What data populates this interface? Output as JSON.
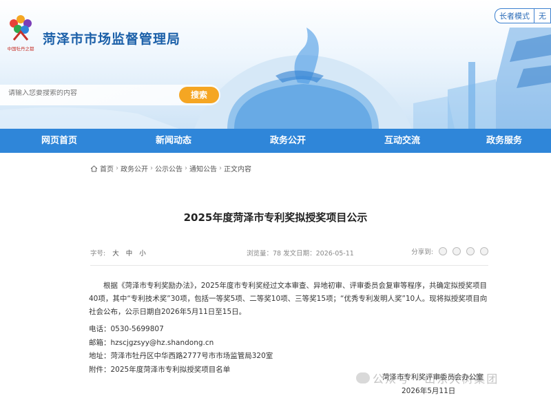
{
  "header": {
    "site_title": "菏泽市市场监督管理局",
    "logo_caption": "中国牡丹之都",
    "top_links": [
      "长者模式",
      "无"
    ]
  },
  "search": {
    "placeholder": "请输入您要搜索的内容",
    "button": "搜索"
  },
  "nav": {
    "items": [
      "网页首页",
      "新闻动态",
      "政务公开",
      "互动交流",
      "政务服务"
    ]
  },
  "breadcrumb": {
    "items": [
      "首页",
      "政务公开",
      "公示公告",
      "通知公告",
      "正文内容"
    ],
    "separator": "›"
  },
  "article": {
    "title": "2025年度菏泽市专利奖拟授奖项目公示",
    "font_size_label": "字号:",
    "font_sizes": [
      "大",
      "中",
      "小"
    ],
    "info": "浏览量：78 发文日期：2026-05-11",
    "share_label": "分享到:",
    "share_icons": [
      "qq-icon",
      "weibo-icon",
      "wechat-icon",
      "qzone-icon"
    ],
    "paragraph": "根据《菏泽市专利奖励办法》，2025年度市专利奖经过文本审查、异地初审、评审委员会复审等程序，共确定拟授奖项目40项，其中“专利技术奖”30项，包括一等奖5项、二等奖10项、三等奖15项；“优秀专利发明人奖”10人。现将拟授奖项目向社会公布，公示日期自2026年5月11日至15日。",
    "phone": "电话：0530-5699807",
    "email": "邮箱：hzscjgzsyy@hz.shandong.cn",
    "address": "地址：菏泽市牡丹区中华西路2777号市市场监管局320室",
    "attachment": "附件：2025年度菏泽市专利拟授奖项目名单",
    "signer": "菏泽市专利奖评审委员会办公室",
    "date": "2026年5月11日"
  },
  "watermark": "公众号 · 山东大树集团",
  "colors": {
    "nav_blue": "#2f86d9",
    "title_blue": "#1a5fa8",
    "search_orange": "#f5a623"
  }
}
